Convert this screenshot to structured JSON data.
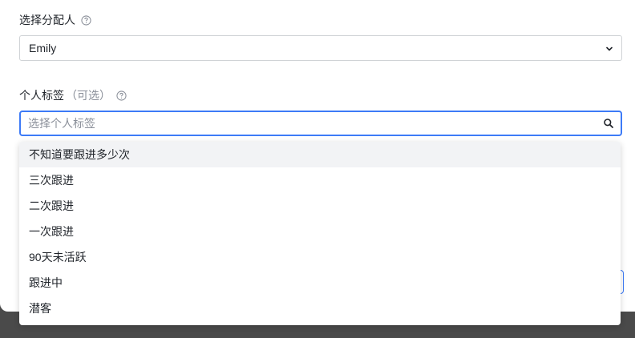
{
  "assignee": {
    "label": "选择分配人",
    "help_icon": "question-circle-icon",
    "selected_value": "Emily",
    "chevron_icon": "chevron-down-icon"
  },
  "tags": {
    "label": "个人标签",
    "optional_note": "（可选）",
    "help_icon": "question-circle-icon",
    "placeholder": "选择个人标签",
    "search_icon": "search-icon",
    "options": [
      "不知道要跟进多少次",
      "三次跟进",
      "二次跟进",
      "一次跟进",
      "90天未活跃",
      "跟进中",
      "潜客"
    ],
    "hovered_index": 0
  },
  "colors": {
    "accent": "#3d7bf7",
    "hover_bg": "#f2f3f5",
    "overlay": "#4a4a4a"
  }
}
